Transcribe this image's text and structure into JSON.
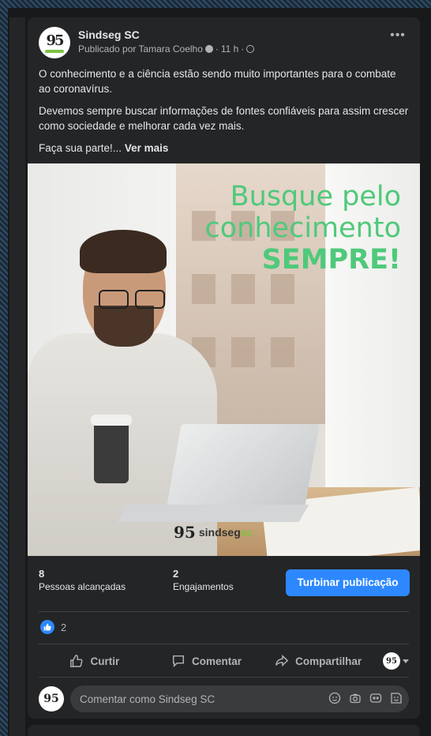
{
  "post": {
    "page_name": "Sindseg SC",
    "published_by": "Publicado por Tamara Coelho",
    "time": "11 h",
    "text_paragraphs": [
      "O conhecimento e a ciência estão sendo muito importantes para o combate ao coronavírus.",
      "Devemos sempre buscar informações de fontes confiáveis para assim crescer como sociedade e melhorar cada vez mais.",
      "Faça sua parte!..."
    ],
    "see_more": "Ver mais",
    "image": {
      "headline_line1": "Busque pelo",
      "headline_line2": "conhecimento",
      "headline_line3": "SEMPRE!",
      "logo_number": "95",
      "logo_text": "sindseg",
      "logo_suffix": "sc",
      "headline_color": "#4fc97a"
    },
    "avatar_text": "95"
  },
  "stats": {
    "reached_count": "8",
    "reached_label": "Pessoas alcançadas",
    "engagement_count": "2",
    "engagement_label": "Engajamentos",
    "boost_label": "Turbinar publicação"
  },
  "reactions": {
    "like_count": "2"
  },
  "actions": {
    "like": "Curtir",
    "comment": "Comentar",
    "share": "Compartilhar"
  },
  "comment": {
    "placeholder": "Comentar como Sindseg SC"
  },
  "colors": {
    "accent": "#2d88ff",
    "card_bg": "#242526",
    "page_bg": "#18191a"
  }
}
